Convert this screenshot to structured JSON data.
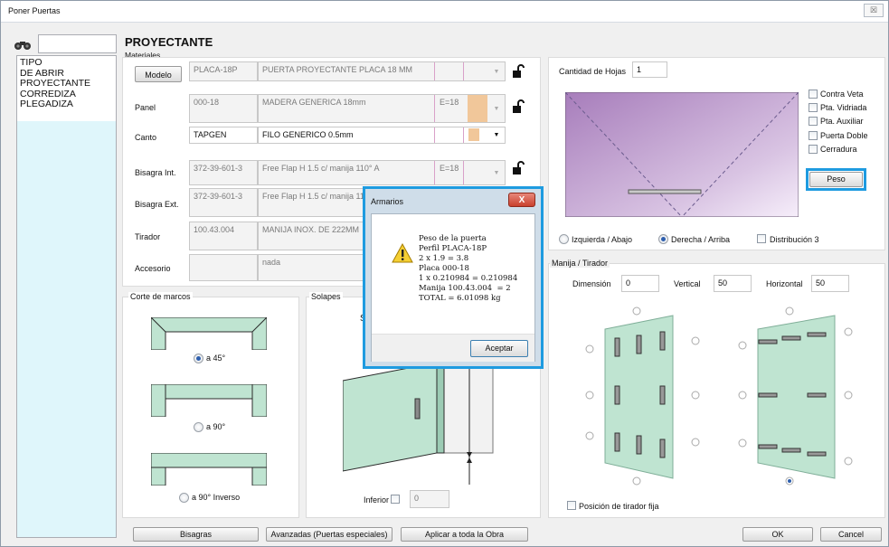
{
  "window": {
    "title": "Poner Puertas",
    "close_glyph": "☒"
  },
  "left": {
    "search_value": "",
    "search_icon": "binoculars-icon",
    "items": [
      "TIPO",
      "DE ABRIR",
      "PROYECTANTE",
      "CORREDIZA",
      "PLEGADIZA"
    ]
  },
  "header": {
    "title": "PROYECTANTE",
    "section": "Materiales"
  },
  "materials": {
    "modelo_button": "Modelo",
    "rows": [
      {
        "label": "",
        "code": "PLACA-18P",
        "desc": "PUERTA PROYECTANTE PLACA 18 MM",
        "extra": ""
      },
      {
        "label": "Panel",
        "code": "000-18",
        "desc": "MADERA GENERICA 18mm",
        "extra": "E=18"
      },
      {
        "label": "Canto",
        "code": "TAPGEN",
        "desc": "FILO GENERICO 0.5mm",
        "extra": ""
      },
      {
        "label": "Bisagra Int.",
        "code": "372-39-601-3",
        "desc": "Free Flap H 1.5 c/ manija 110° A",
        "extra": "E=18"
      },
      {
        "label": "Bisagra Ext.",
        "code": "372-39-601-3",
        "desc": "Free Flap H 1.5 c/ manija 11",
        "extra": ""
      },
      {
        "label": "Tirador",
        "code": "100.43.004",
        "desc": "MANIJA INOX. DE 222MM",
        "extra": ""
      },
      {
        "label": "Accesorio",
        "code": "",
        "desc": "nada",
        "extra": ""
      }
    ]
  },
  "corte": {
    "title": "Corte de marcos",
    "options": [
      {
        "label": "a 45°",
        "selected": true
      },
      {
        "label": "a 90°",
        "selected": false
      },
      {
        "label": "a 90° Inverso",
        "selected": false
      }
    ]
  },
  "solapes": {
    "title": "Solapes",
    "partial_label": "S",
    "inferior_label": "Inferior",
    "inferior_value": "0"
  },
  "hojas": {
    "label": "Cantidad de Hojas",
    "value": "1",
    "checks": [
      "Contra Veta",
      "Pta. Vidriada",
      "Pta. Auxiliar",
      "Puerta Doble",
      "Cerradura"
    ],
    "peso_button": "Peso",
    "radio_left": "Izquierda / Abajo",
    "radio_right": "Derecha / Arriba",
    "distribucion": "Distribución 3"
  },
  "manija": {
    "title": "Manija / Tirador",
    "dimension_label": "Dimensión",
    "dimension_value": "0",
    "vertical_label": "Vertical",
    "vertical_value": "50",
    "horizontal_label": "Horizontal",
    "horizontal_value": "50",
    "fixed_label": "Posición de tirador fija"
  },
  "footer": {
    "bisagras": "Bisagras",
    "avanzadas": "Avanzadas (Puertas especiales)",
    "aplicar": "Aplicar a toda la Obra",
    "ok": "OK",
    "cancel": "Cancel"
  },
  "dialog": {
    "title": "Armarios",
    "close": "X",
    "lines": [
      "Peso de la puerta",
      "Perfil PLACA-18P",
      "2 x 1.9 = 3.8",
      "Placa 000-18",
      "1 x 0.210984 = 0.210984",
      "Manija 100.43.004  = 2",
      "TOTAL = 6.01098 kg"
    ],
    "accept": "Aceptar",
    "icon": "warning-icon"
  },
  "colors": {
    "accent_blue": "#1e9be0",
    "door_green": "#bfe4d1",
    "preview_purple": "#b48bc6"
  }
}
